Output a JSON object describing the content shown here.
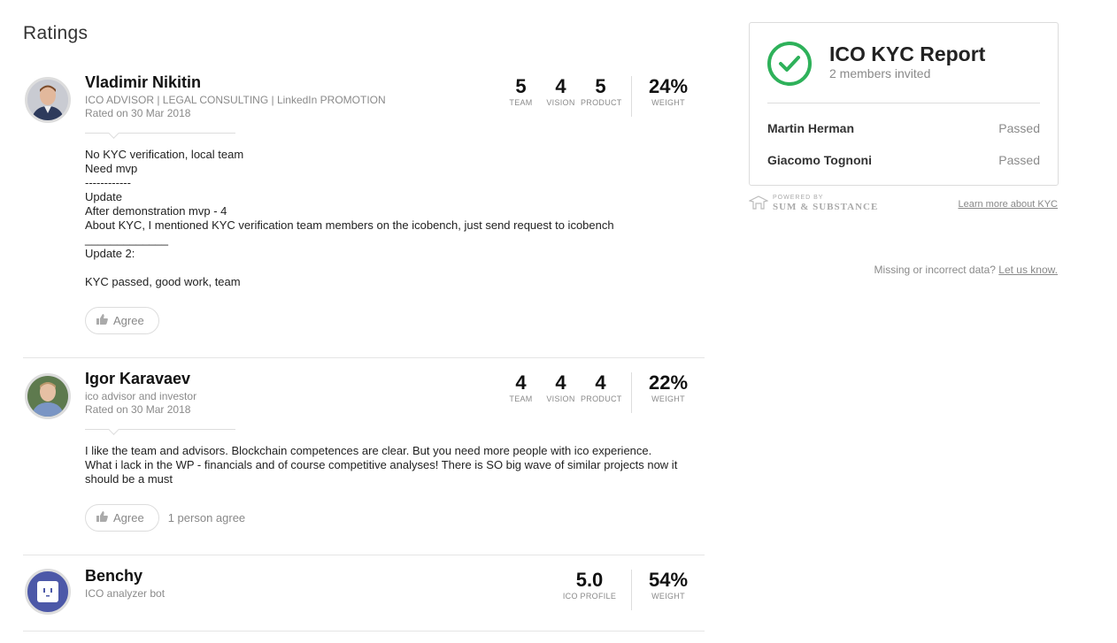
{
  "section_title": "Ratings",
  "ratings": [
    {
      "name": "Vladimir Nikitin",
      "title": "ICO ADVISOR | LEGAL CONSULTING | LinkedIn PROMOTION",
      "date": "Rated on 30 Mar 2018",
      "team": "5",
      "team_label": "TEAM",
      "vision": "4",
      "vision_label": "VISION",
      "product": "5",
      "product_label": "PRODUCT",
      "weight": "24%",
      "weight_label": "WEIGHT",
      "comment": [
        "No KYC verification, local team",
        "Need mvp",
        "------------",
        "Update",
        "After demonstration mvp - 4",
        "About KYC, I mentioned KYC verification team members on the icobench, just send request to icobench",
        "_____________",
        "Update 2:",
        "",
        "KYC passed, good work, team"
      ],
      "agree_label": "Agree",
      "agree_count": ""
    },
    {
      "name": "Igor Karavaev",
      "title": "ico advisor and investor",
      "date": "Rated on 30 Mar 2018",
      "team": "4",
      "team_label": "TEAM",
      "vision": "4",
      "vision_label": "VISION",
      "product": "4",
      "product_label": "PRODUCT",
      "weight": "22%",
      "weight_label": "WEIGHT",
      "comment": [
        "I like the team and advisors. Blockchain competences are clear. But you need more people with ico experience.",
        "What i lack in the WP - financials and of course competitive analyses! There is SO big wave of similar projects now it should be a must"
      ],
      "agree_label": "Agree",
      "agree_count": "1 person agree"
    },
    {
      "name": "Benchy",
      "title": "ICO analyzer bot",
      "profile_score": "5.0",
      "profile_label": "ICO PROFILE",
      "weight": "54%",
      "weight_label": "WEIGHT"
    }
  ],
  "kyc": {
    "title": "ICO KYC Report",
    "subtitle": "2 members invited",
    "members": [
      {
        "name": "Martin Herman",
        "status": "Passed"
      },
      {
        "name": "Giacomo Tognoni",
        "status": "Passed"
      }
    ],
    "powered_by": "POWERED BY",
    "provider": "SUM & SUBSTANCE",
    "learn_more": "Learn more about KYC",
    "check_color": "#2eb15a"
  },
  "missing_text": "Missing or incorrect data?",
  "missing_link": "Let us know."
}
